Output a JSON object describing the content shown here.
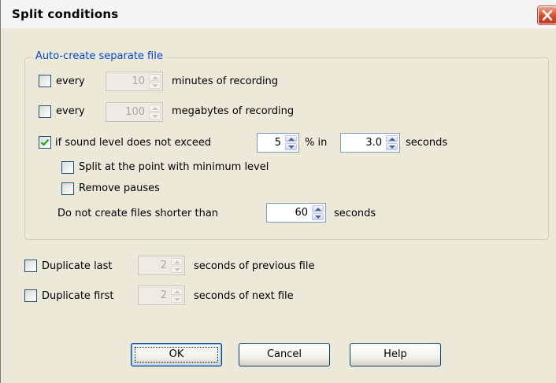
{
  "window": {
    "title": "Split conditions"
  },
  "auto_create": {
    "legend": "Auto-create separate file",
    "every_minutes": {
      "checked": false,
      "label": "every",
      "value": "10",
      "unit": "minutes of recording",
      "enabled": false
    },
    "every_megabytes": {
      "checked": false,
      "label": "every",
      "value": "100",
      "unit": "megabytes of recording",
      "enabled": false
    },
    "sound_level": {
      "checked": true,
      "label": "if sound level does not exceed",
      "level_value": "5",
      "level_unit": "% in",
      "duration_value": "3.0",
      "duration_unit": "seconds"
    },
    "split_at_min": {
      "checked": false,
      "label": "Split at the point with minimum level"
    },
    "remove_pauses": {
      "checked": false,
      "label": "Remove pauses"
    },
    "min_length": {
      "label": "Do not create files shorter than",
      "value": "60",
      "unit": "seconds"
    }
  },
  "duplicate_last": {
    "checked": false,
    "label": "Duplicate last",
    "value": "2",
    "unit": "seconds of previous file",
    "enabled": false
  },
  "duplicate_first": {
    "checked": false,
    "label": "Duplicate first",
    "value": "2",
    "unit": "seconds of next file",
    "enabled": false
  },
  "buttons": {
    "ok": "OK",
    "cancel": "Cancel",
    "help": "Help"
  },
  "colors": {
    "dialog_bg": "#ece9d8",
    "legend_text": "#0046d5",
    "close_button": "#d24a2a",
    "check_mark": "#21a121"
  }
}
